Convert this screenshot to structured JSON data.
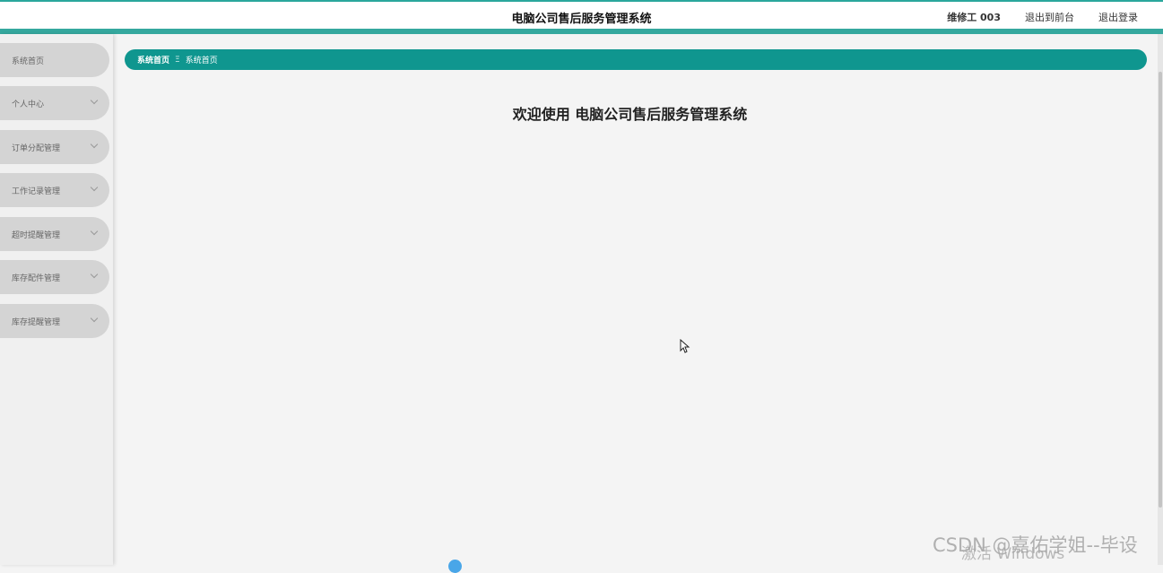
{
  "header": {
    "title": "电脑公司售后服务管理系统",
    "user": "维修工 003",
    "to_front_label": "退出到前台",
    "logout_label": "退出登录"
  },
  "sidebar": {
    "items": [
      {
        "label": "系统首页",
        "has_submenu": false
      },
      {
        "label": "个人中心",
        "has_submenu": true
      },
      {
        "label": "订单分配管理",
        "has_submenu": true
      },
      {
        "label": "工作记录管理",
        "has_submenu": true
      },
      {
        "label": "超时提醒管理",
        "has_submenu": true
      },
      {
        "label": "库存配件管理",
        "has_submenu": true
      },
      {
        "label": "库存提醒管理",
        "has_submenu": true
      }
    ]
  },
  "breadcrumb": {
    "home": "系统首页",
    "separator": "Ξ",
    "current": "系统首页"
  },
  "main": {
    "welcome": "欢迎使用 电脑公司售后服务管理系统"
  },
  "overlay": {
    "activate_windows": "激活 Windows",
    "csdn_watermark": "CSDN @嘉佑学姐--毕设"
  },
  "colors": {
    "accent": "#35a89e",
    "breadcrumb_bg": "#0f968f",
    "sidebar_item_bg": "#d4d4d4"
  }
}
